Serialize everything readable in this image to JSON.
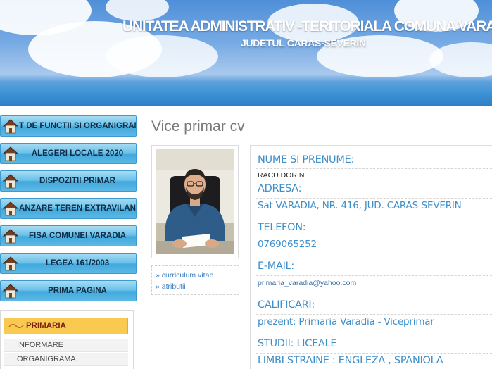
{
  "header": {
    "title": "UNITATEA ADMINISTRATIV -TERITORIALA COMUNA VARADIA",
    "subtitle": "JUDETUL CARAS-SEVERIN"
  },
  "nav": {
    "items": [
      {
        "label": "T DE FUNCTII SI ORGANIGRAMA"
      },
      {
        "label": "ALEGERI LOCALE 2020"
      },
      {
        "label": "DISPOZITII PRIMAR"
      },
      {
        "label": "ANZARE TEREN EXTRAVILAN"
      },
      {
        "label": "FISA COMUNEI VARADIA"
      },
      {
        "label": "LEGEA 161/2003"
      },
      {
        "label": "PRIMA PAGINA"
      }
    ]
  },
  "side_menu": {
    "heading": "PRIMARIA",
    "items": [
      "INFORMARE",
      "ORGANIGRAMA"
    ]
  },
  "page": {
    "title": "Vice primar cv"
  },
  "links": [
    "» curriculum vitae",
    "» atributii"
  ],
  "profile": {
    "name_label": "NUME SI PRENUME:",
    "name_value": "RACU DORIN",
    "address_label": "ADRESA:",
    "address_value": "Sat VARADIA, NR. 416, JUD. CARAS-SEVERIN",
    "phone_label": "TELEFON:",
    "phone_value": "0769065252",
    "email_label": "E-MAIL:",
    "email_value": "primaria_varadia@yahoo.com",
    "qual_label": "CALIFICARI:",
    "qual_value": "prezent: Primaria Varadia - Viceprimar",
    "studies_label": "STUDII: LICEALE",
    "languages_label": "LIMBI STRAINE : ENGLEZA , SPANIOLA"
  },
  "colors": {
    "accent_blue": "#3e8ec9",
    "nav_blue": "#6cc2ea",
    "primaria_yellow": "#f9c950"
  },
  "icons": {
    "nav": "home-icon",
    "side_heading": "wave-icon"
  }
}
